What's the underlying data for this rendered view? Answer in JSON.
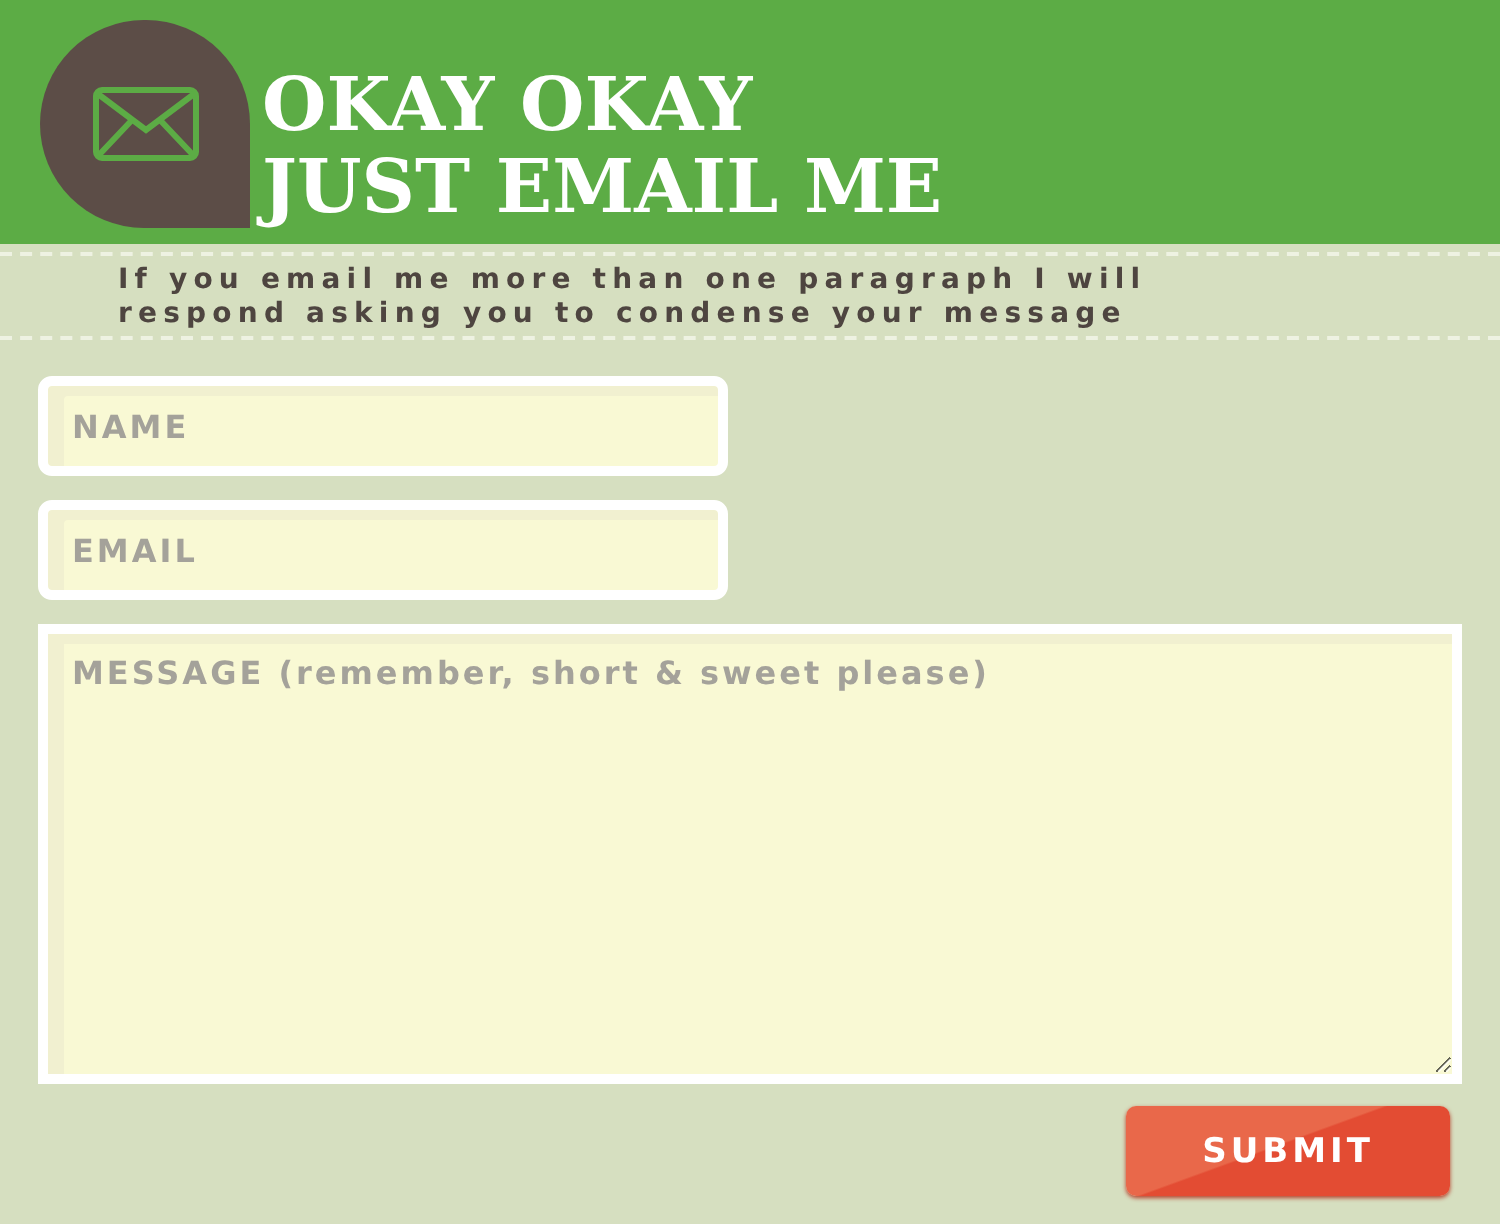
{
  "header": {
    "title_lines": [
      "OKAY OKAY",
      "JUST EMAIL ME"
    ]
  },
  "note": "If you email me more than one paragraph I will respond asking you to condense your message",
  "form": {
    "fields": [
      {
        "kind": "line",
        "placeholder": "NAME"
      },
      {
        "kind": "line",
        "placeholder": "EMAIL"
      },
      {
        "kind": "area",
        "placeholder": "MESSAGE (remember, short & sweet please)"
      }
    ],
    "submit": "SUBMIT"
  }
}
